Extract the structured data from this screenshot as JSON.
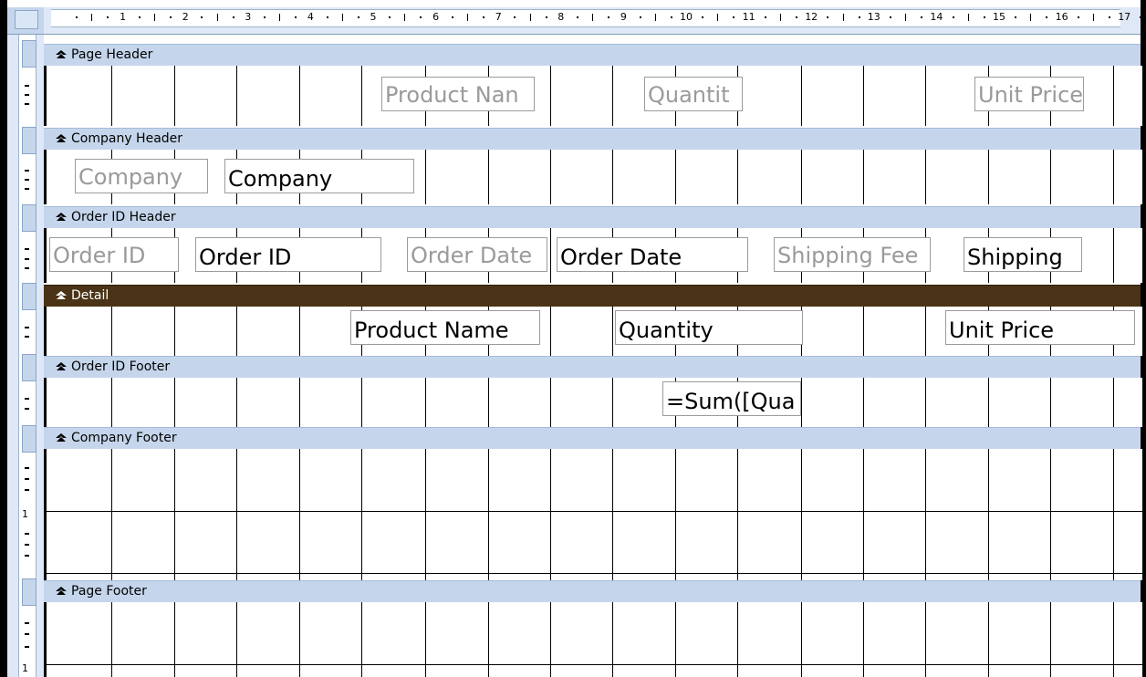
{
  "ruler": {
    "top_numbers": [
      "1",
      "2",
      "3",
      "4",
      "5",
      "6",
      "7",
      "8",
      "9",
      "10",
      "11",
      "12",
      "13",
      "14",
      "15",
      "16",
      "17"
    ],
    "left_numbers": [
      "1",
      "1"
    ]
  },
  "sections": {
    "page_header": {
      "title": "Page Header",
      "labels": {
        "product_name": "Product Nan",
        "quantity": "Quantit",
        "unit_price": "Unit Price"
      }
    },
    "company_header": {
      "title": "Company Header",
      "label": "Company",
      "textbox": "Company"
    },
    "order_id_header": {
      "title": "Order ID Header",
      "order_id_label": "Order ID",
      "order_id_textbox": "Order ID",
      "order_date_label": "Order Date",
      "order_date_textbox": "Order Date",
      "shipping_fee_label": "Shipping Fee",
      "shipping_textbox": "Shipping"
    },
    "detail": {
      "title": "Detail",
      "product_name": "Product Name",
      "quantity": "Quantity",
      "unit_price": "Unit Price"
    },
    "order_id_footer": {
      "title": "Order ID Footer",
      "sum_textbox": "=Sum([Qua"
    },
    "company_footer": {
      "title": "Company Footer"
    },
    "page_footer": {
      "title": "Page Footer"
    }
  },
  "colors": {
    "band": "#c5d6ec",
    "band_selected": "#4a3316",
    "grid": "#000000",
    "label_text": "#9a9a9a",
    "textbox_text": "#000000"
  },
  "icons": {
    "band_collapse": "chevron-up-icon"
  }
}
